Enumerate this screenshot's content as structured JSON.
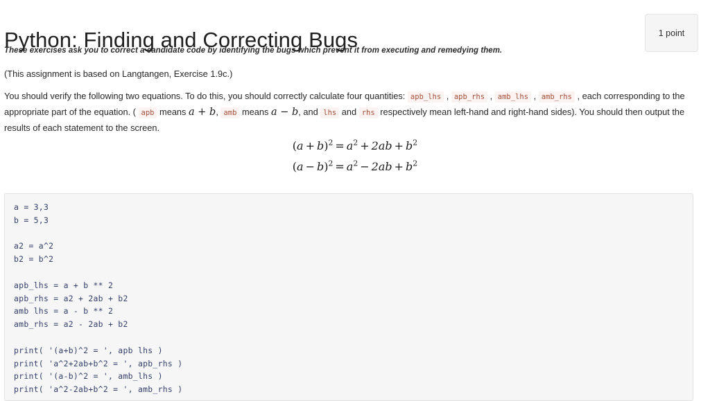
{
  "header": {
    "title": "Python: Finding and Correcting Bugs",
    "points_badge": "1 point"
  },
  "intro": {
    "subtitle": "These exercises ask you to correct a candidate code by identifying the bugs which prevent it from executing and remedying them.",
    "note": "(This assignment is based on Langtangen, Exercise 1.9c.)",
    "paragraph": {
      "seg1": "You should verify the following two equations. To do this, you should correctly calculate four quantities: ",
      "code_apb_lhs": "apb_lhs",
      "comma1": " , ",
      "code_apb_rhs": "apb_rhs",
      "comma2": " , ",
      "code_amb_lhs": "amb_lhs",
      "comma3": " , ",
      "code_amb_rhs": "amb_rhs",
      "seg2": " , each corresponding to the appropriate part of the equation. ( ",
      "code_apb": "apb",
      "seg3": " means ",
      "math_apb": "a + b",
      "seg4": ", ",
      "code_amb": "amb",
      "seg5": " means ",
      "math_amb": "a − b",
      "seg6": ", and ",
      "code_lhs": "lhs",
      "seg7": " and ",
      "code_rhs": "rhs",
      "seg8": " respectively mean left-hand and right-hand sides). You should then output the results of each statement to the screen."
    }
  },
  "equations": [
    {
      "id": "eq-expand-plus",
      "lhs_open": "(",
      "lhs_a": "a",
      "lhs_op": "+",
      "lhs_b": "b",
      "lhs_close": ")",
      "lhs_pow": "2",
      "equals": "=",
      "t1_base": "a",
      "t1_pow": "2",
      "op1": "+",
      "t2": "2ab",
      "op2": "+",
      "t3_base": "b",
      "t3_pow": "2",
      "plain": "(a + b)^2 = a^2 + 2ab + b^2"
    },
    {
      "id": "eq-expand-minus",
      "lhs_open": "(",
      "lhs_a": "a",
      "lhs_op": "−",
      "lhs_b": "b",
      "lhs_close": ")",
      "lhs_pow": "2",
      "equals": "=",
      "t1_base": "a",
      "t1_pow": "2",
      "op1": "−",
      "t2": "2ab",
      "op2": "+",
      "t3_base": "b",
      "t3_pow": "2",
      "plain": "(a − b)^2 = a^2 − 2ab + b^2"
    }
  ],
  "code_block": {
    "language": "python",
    "lines": [
      "a = 3,3",
      "b = 5,3",
      "",
      "a2 = a^2",
      "b2 = b^2",
      "",
      "apb_lhs = a + b ** 2",
      "apb_rhs = a2 + 2ab + b2",
      "amb lhs = a - b ** 2",
      "amb_rhs = a2 - 2ab + b2",
      "",
      "print( '(a+b)^2 = ', apb lhs )",
      "print( 'a^2+2ab+b^2 = ', apb_rhs )",
      "print( '(a-b)^2 = ', amb_lhs )",
      "print( 'a^2-2ab+b^2 = ', amb_rhs )"
    ]
  },
  "colors": {
    "page_background": "#ffffff",
    "text": "#262626",
    "code_background": "#f6f6f6",
    "code_border": "#e1e1e1",
    "code_text": "#34406b",
    "inline_code_background": "#fbf2f2",
    "inline_code_text": "#a4503a",
    "badge_background": "#f5f5f5",
    "badge_border": "#e4e4e4"
  }
}
